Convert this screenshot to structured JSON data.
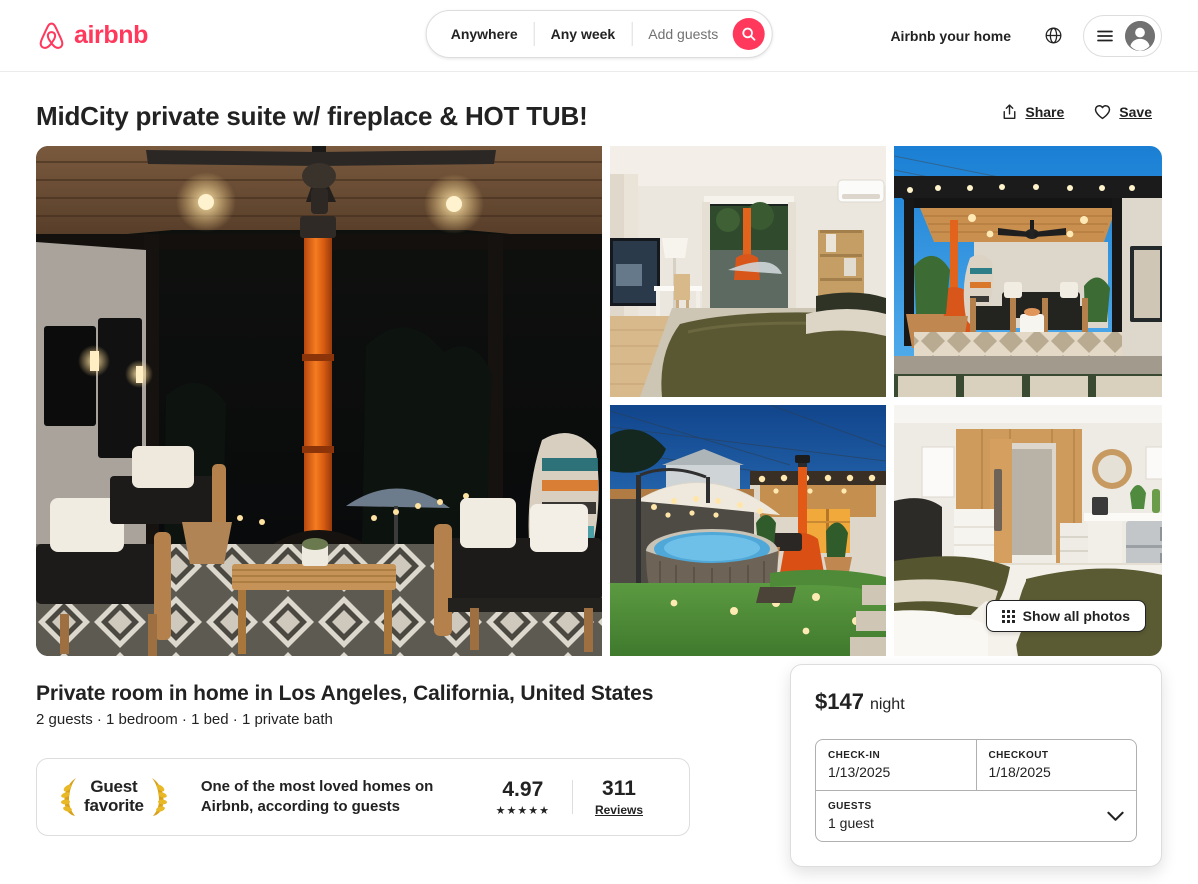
{
  "header": {
    "brand": "airbnb",
    "brand_color": "#FF385C",
    "search": {
      "location": "Anywhere",
      "dates": "Any week",
      "guests_placeholder": "Add guests",
      "search_icon": "search-icon"
    },
    "host_link": "Airbnb your home",
    "globe_icon": "globe-icon",
    "menu_icon": "hamburger-menu-icon",
    "avatar_icon": "user-avatar-icon"
  },
  "listing": {
    "title": "MidCity private suite w/ fireplace & HOT TUB!",
    "share_label": "Share",
    "save_label": "Save",
    "subtitle": "Private room in home in Los Angeles, California, United States",
    "specs": "2 guests · 1 bedroom · 1 bed · 1 private bath"
  },
  "gallery": {
    "show_all_label": "Show all photos",
    "photos": [
      {
        "position": "hero",
        "alt": "Covered patio at night with ceiling fan, orange chimney heater, lounge chairs and patterned tile floor"
      },
      {
        "position": "top-middle",
        "alt": "Bedroom with olive green bedding, TV, desk and doors opening to the patio"
      },
      {
        "position": "top-right",
        "alt": "Daytime covered patio with wood ceiling, orange chimney, string lights and blue sky"
      },
      {
        "position": "bottom-middle",
        "alt": "Backyard at dusk with hot tub, lit umbrella and green lawn"
      },
      {
        "position": "bottom-right",
        "alt": "Bedroom with wood accent wall, round mirror, mini fridge and olive bedding"
      }
    ]
  },
  "guest_favorite": {
    "badge_line1": "Guest",
    "badge_line2": "favorite",
    "tagline": "One of the most loved homes on Airbnb, according to guests",
    "rating": "4.97",
    "stars": "★★★★★",
    "reviews_count": "311",
    "reviews_label": "Reviews"
  },
  "booking": {
    "price": "$147",
    "price_unit": "night",
    "checkin_label": "CHECK-IN",
    "checkin_value": "1/13/2025",
    "checkout_label": "CHECKOUT",
    "checkout_value": "1/18/2025",
    "guests_label": "GUESTS",
    "guests_value": "1 guest",
    "chevron_icon": "chevron-down-icon"
  }
}
